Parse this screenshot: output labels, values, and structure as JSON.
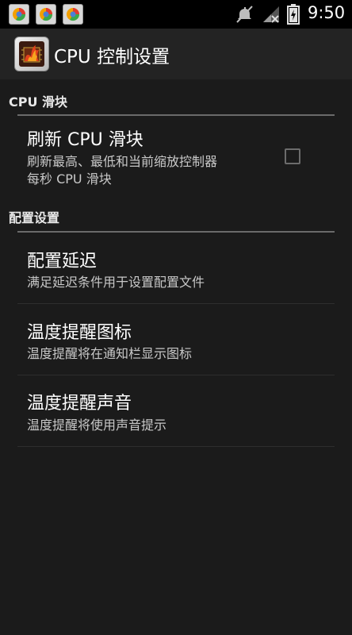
{
  "status_bar": {
    "time": "9:50",
    "notification_icons": [
      "app-notification-icon",
      "app-notification-icon",
      "app-notification-icon"
    ],
    "right_icons": [
      "mute-icon",
      "signal-icon",
      "battery-icon"
    ]
  },
  "action_bar": {
    "title": "CPU 控制设置",
    "app_icon": "cpu-app-icon"
  },
  "categories": [
    {
      "label": "CPU 滑块"
    },
    {
      "label": "配置设置"
    }
  ],
  "preferences": [
    {
      "title": "刷新 CPU 滑块",
      "summary_line1": "刷新最高、最低和当前缩放控制器",
      "summary_line2": "每秒 CPU 滑块",
      "checked": false
    },
    {
      "title": "配置延迟",
      "summary": "满足延迟条件用于设置配置文件"
    },
    {
      "title": "温度提醒图标",
      "summary": "温度提醒将在通知栏显示图标"
    },
    {
      "title": "温度提醒声音",
      "summary": "温度提醒将使用声音提示"
    }
  ],
  "colors": {
    "background": "#1b1b1b",
    "action_bar": "#232323",
    "status_bar": "#000000",
    "category_divider": "#6a6a6a"
  }
}
